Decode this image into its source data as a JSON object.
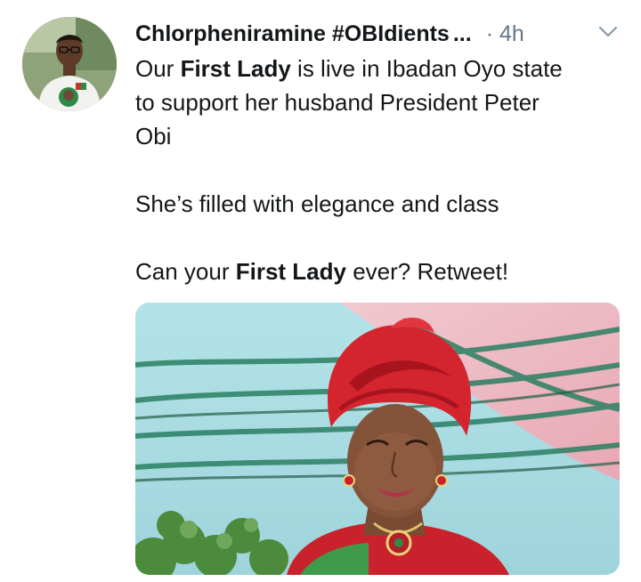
{
  "tweet": {
    "author_name": "Chlorpheniramine #OBIdients",
    "name_ellipsis": "...",
    "time": "· 4h",
    "lines": {
      "l1_pre": "Our ",
      "l1_bold": "First Lady",
      "l1_post": " is live in Ibadan Oyo state",
      "l2": "to support her husband President Peter",
      "l3": "Obi",
      "l4": "She’s filled with elegance and class",
      "l5_pre": "Can your ",
      "l5_bold": "First Lady",
      "l5_post": " ever? Retweet!"
    },
    "icons": {
      "more": "chevron-down-icon"
    },
    "colors": {
      "text": "#14171a",
      "secondary": "#657786",
      "headwrap": "#d4242e"
    }
  }
}
